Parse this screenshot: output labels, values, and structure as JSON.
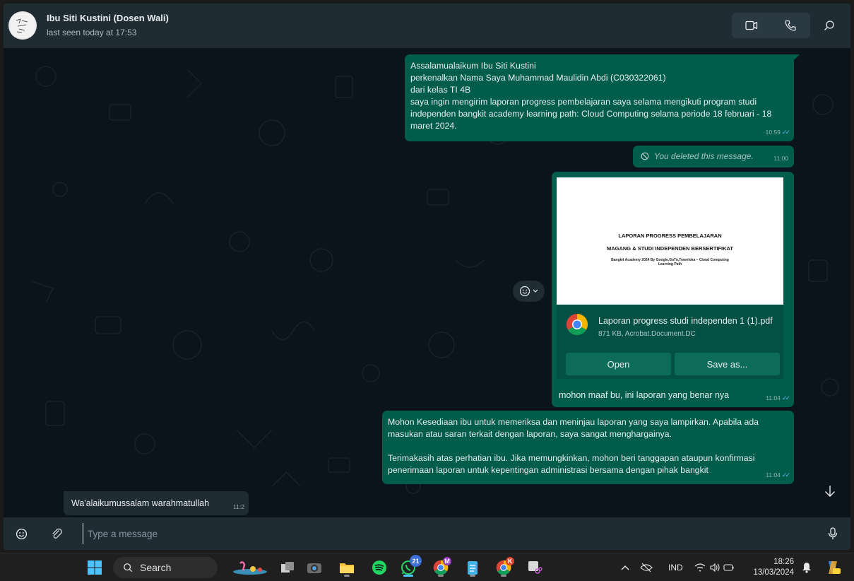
{
  "header": {
    "contact_name": "Ibu Siti Kustini (Dosen Wali)",
    "status": "last seen today at 17:53",
    "icons": [
      "video-call-icon",
      "voice-call-icon",
      "search-icon"
    ]
  },
  "messages": {
    "m1": {
      "text": "Assalamualaikum Ibu Siti Kustini\nperkenalkan Nama Saya Muhammad Maulidin Abdi (C030322061)\ndari kelas TI 4B\nsaya ingin mengirim laporan progress pembelajaran saya selama mengikuti program studi independen bangkit academy learning path: Cloud Computing selama periode 18 februari - 18 maret 2024.",
      "time": "10:59"
    },
    "m2": {
      "text": "You deleted this message.",
      "time": "11:00"
    },
    "m3": {
      "preview_title_1": "LAPORAN PROGRESS PEMBELAJARAN",
      "preview_title_2": "MAGANG & STUDI INDEPENDEN BERSERTIFIKAT",
      "preview_subtitle": "Bangkit Academy 2024 By Google,GoTo,Traveloka – Cloud Computing Learning Path",
      "file_name": "Laporan progress studi independen 1 (1).pdf",
      "file_meta": "871 KB, Acrobat.Document.DC",
      "open_label": "Open",
      "save_label": "Save as...",
      "caption": "mohon maaf bu, ini laporan yang benar nya",
      "time": "11:04"
    },
    "m4": {
      "text": "Mohon Kesediaan ibu untuk memeriksa dan meninjau laporan yang saya lampirkan. Apabila ada masukan atau saran terkait dengan laporan, saya sangat menghargainya.\n\nTerimakasih atas perhatian ibu. Jika memungkinkan, mohon beri tanggapan ataupun konfirmasi penerimaan laporan untuk kepentingan administrasi bersama dengan pihak bangkit",
      "time": "11:04"
    },
    "m5": {
      "text": "Wa'alaikumussalam warahmatullah",
      "time": "11:2"
    }
  },
  "compose": {
    "placeholder": "Type a message"
  },
  "taskbar": {
    "search_label": "Search",
    "whatsapp_badge": "21",
    "chrome_badge_1": "M",
    "chrome_badge_2": "K",
    "language": "IND",
    "time": "18:26",
    "date": "13/03/2024"
  },
  "colors": {
    "outgoing_bubble": "#005c4b",
    "incoming_bubble": "#202c33",
    "header_bg": "#202c33",
    "chat_bg": "#0b141a",
    "read_ticks": "#53bdeb"
  }
}
